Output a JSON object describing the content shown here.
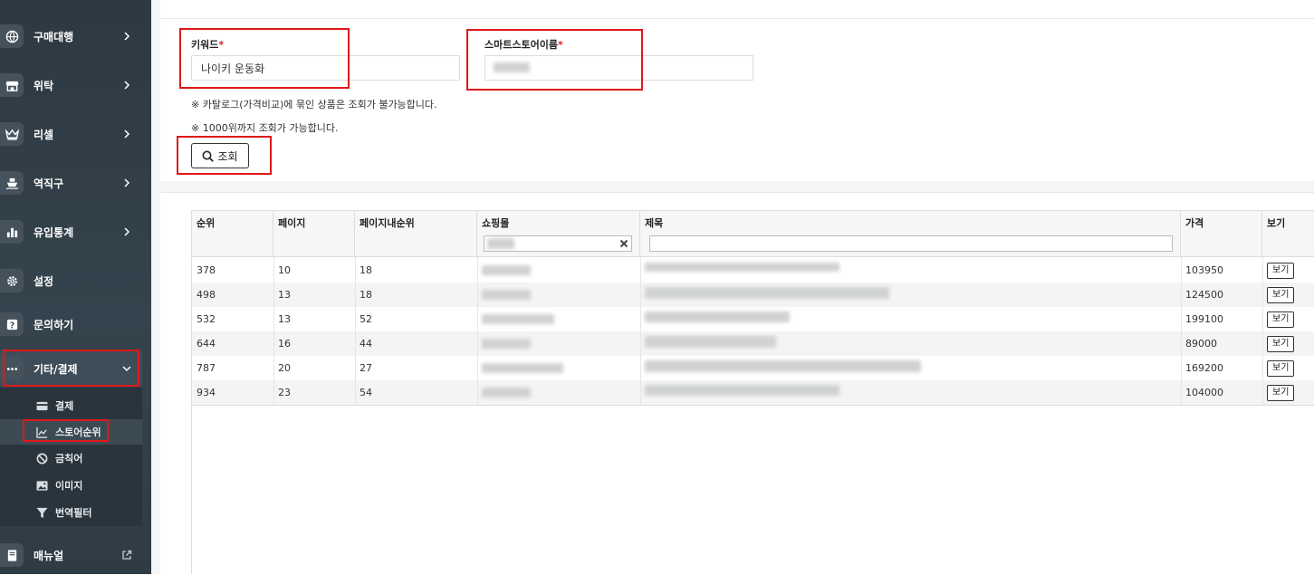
{
  "sidebar": {
    "items": [
      {
        "label": "구매대행",
        "icon": "globe-icon"
      },
      {
        "label": "위탁",
        "icon": "store-icon"
      },
      {
        "label": "리셀",
        "icon": "crown-icon"
      },
      {
        "label": "역직구",
        "icon": "ship-icon"
      },
      {
        "label": "유입통계",
        "icon": "bar-chart-icon"
      },
      {
        "label": "설정",
        "icon": "gear-icon"
      },
      {
        "label": "문의하기",
        "icon": "question-icon"
      },
      {
        "label": "기타/결제",
        "icon": "more-icon"
      },
      {
        "label": "매뉴얼",
        "icon": "book-icon"
      }
    ],
    "submenu": [
      {
        "label": "결제",
        "icon": "credit-card-icon"
      },
      {
        "label": "스토어순위",
        "icon": "line-chart-icon"
      },
      {
        "label": "금칙어",
        "icon": "ban-icon"
      },
      {
        "label": "이미지",
        "icon": "image-icon"
      },
      {
        "label": "번역필터",
        "icon": "filter-icon"
      }
    ]
  },
  "form": {
    "keyword_label": "키워드",
    "keyword_value": "나이키 운동화",
    "store_label": "스마트스토어이름",
    "required_mark": "*",
    "note1": "※ 카탈로그(가격비교)에 묶인 상품은 조회가 불가능합니다.",
    "note2": "※ 1000위까지 조회가 가능합니다.",
    "search_label": "조회"
  },
  "table": {
    "headers": [
      "순위",
      "페이지",
      "페이지내순위",
      "쇼핑몰",
      "제목",
      "가격",
      "보기"
    ],
    "view_label": "보기",
    "rows": [
      {
        "rank": "378",
        "page": "10",
        "page_rank": "18",
        "price": "103950"
      },
      {
        "rank": "498",
        "page": "13",
        "page_rank": "18",
        "price": "124500"
      },
      {
        "rank": "532",
        "page": "13",
        "page_rank": "52",
        "price": "199100"
      },
      {
        "rank": "644",
        "page": "16",
        "page_rank": "44",
        "price": "89000"
      },
      {
        "rank": "787",
        "page": "20",
        "page_rank": "27",
        "price": "169200"
      },
      {
        "rank": "934",
        "page": "23",
        "page_rank": "54",
        "price": "104000"
      }
    ]
  },
  "colors": {
    "highlight": "#e01818",
    "sidebar_bg": "#34434d"
  }
}
